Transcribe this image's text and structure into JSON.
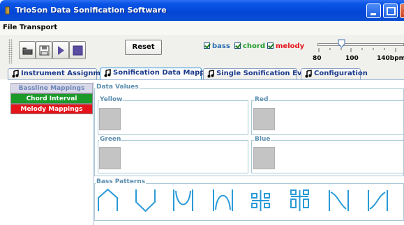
{
  "window": {
    "title": "TrioSon Data Sonification Software"
  },
  "menu": {
    "file": "File",
    "transport": "Transport"
  },
  "toolbar": {
    "reset_label": "Reset",
    "checkboxes": [
      {
        "label": "bass",
        "color": "#2e6fb0",
        "checked": true
      },
      {
        "label": "chord",
        "color": "#1b9a2a",
        "checked": true
      },
      {
        "label": "melody",
        "color": "#e5141a",
        "checked": true
      }
    ],
    "tempo_ticks": [
      "80",
      "100",
      "140bpm"
    ],
    "tempo_value": 100
  },
  "tabs": [
    {
      "label": "Instrument Assignment",
      "active": false
    },
    {
      "label": "Sonification Data Mappings",
      "active": true
    },
    {
      "label": "Single Sonification Events",
      "active": false
    },
    {
      "label": "Configuration",
      "active": false
    }
  ],
  "left_panel": {
    "items": [
      "Bassline Mappings",
      "Chord Interval Mappings",
      "Melody Mappings"
    ]
  },
  "main": {
    "data_values_title": "Data Values",
    "colors": [
      "Yellow",
      "Red",
      "Green",
      "Blue"
    ],
    "bass_patterns_title": "Bass Patterns",
    "patterns": [
      "up-down",
      "down-up",
      "valley",
      "hill",
      "split-down",
      "split-up",
      "descent",
      "ascent"
    ]
  }
}
